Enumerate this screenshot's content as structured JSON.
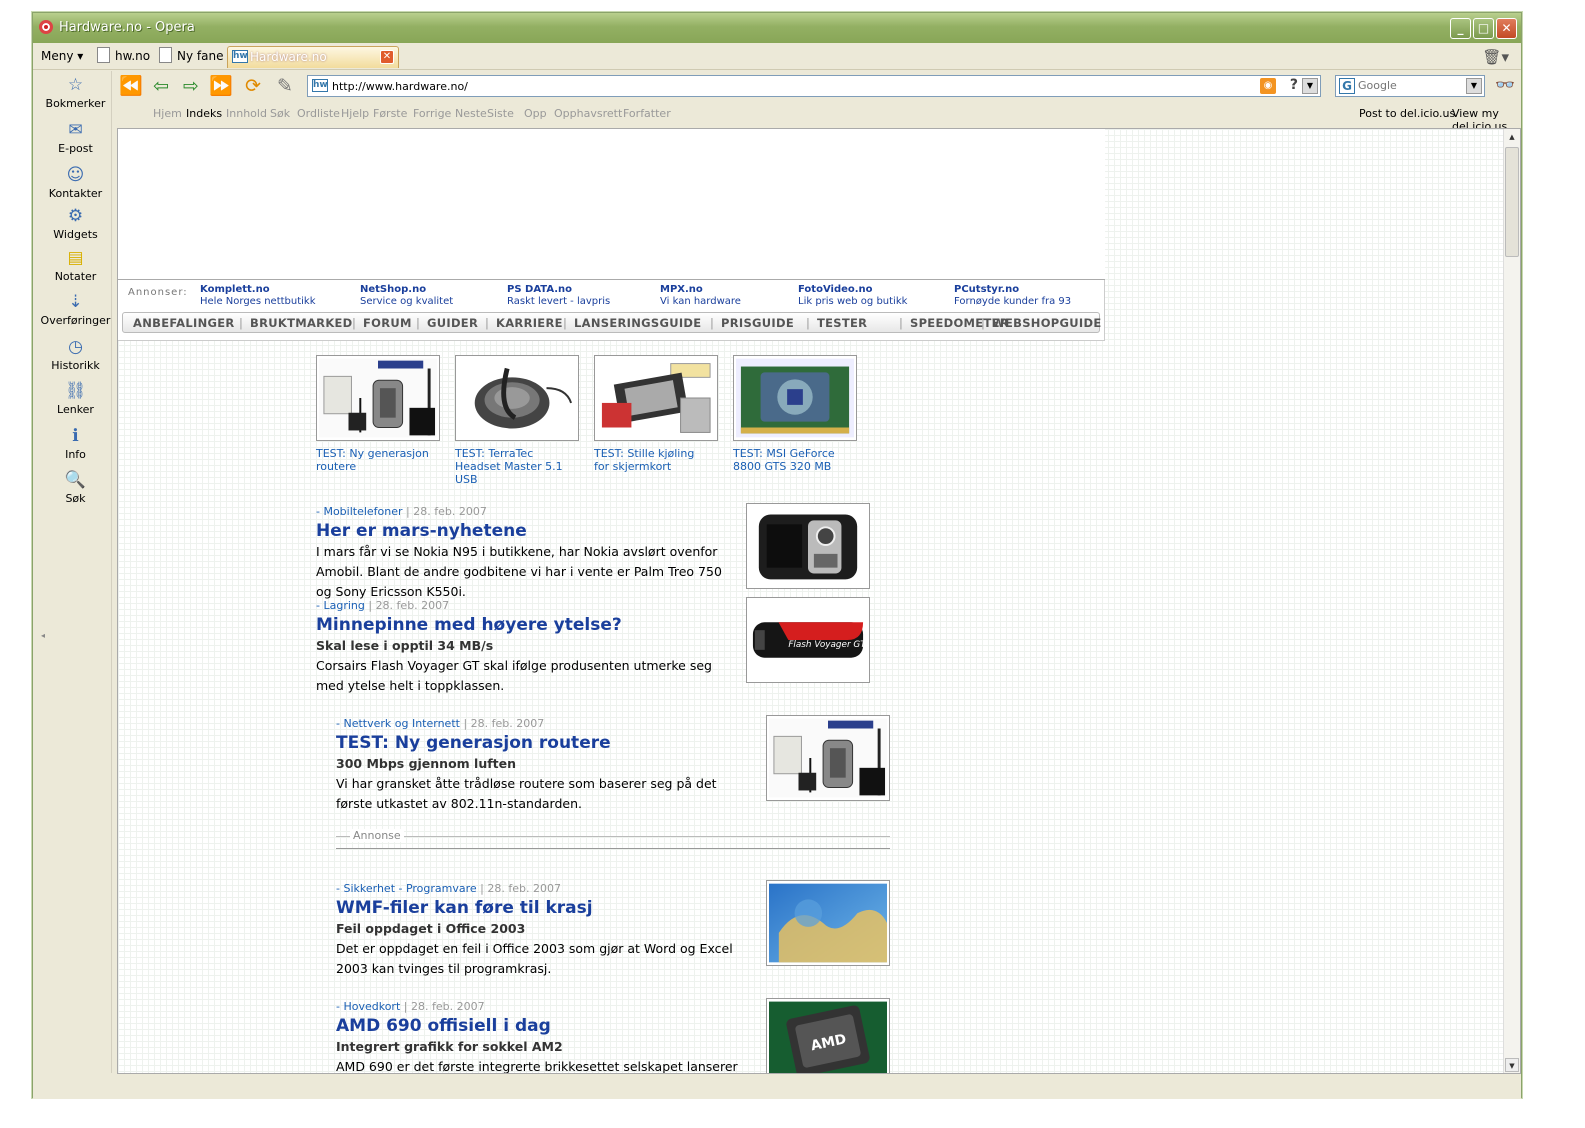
{
  "window": {
    "title": "Hardware.no - Opera"
  },
  "tabbar": {
    "menu_label": "Meny",
    "tabs": [
      {
        "label": "hw.no"
      },
      {
        "label": "Ny fane"
      },
      {
        "label": "Hardware.no",
        "active": true
      }
    ]
  },
  "sidebar": {
    "items": [
      {
        "label": "Bokmerker",
        "icon": "bookmarks-icon"
      },
      {
        "label": "E-post",
        "icon": "mail-icon"
      },
      {
        "label": "Kontakter",
        "icon": "contacts-icon"
      },
      {
        "label": "Widgets",
        "icon": "widgets-icon"
      },
      {
        "label": "Notater",
        "icon": "notes-icon"
      },
      {
        "label": "Overføringer",
        "icon": "transfers-icon"
      },
      {
        "label": "Historikk",
        "icon": "history-icon"
      },
      {
        "label": "Lenker",
        "icon": "links-icon"
      },
      {
        "label": "Info",
        "icon": "info-icon"
      },
      {
        "label": "Søk",
        "icon": "search-icon"
      }
    ]
  },
  "navbar": {
    "address": "http://www.hardware.no/",
    "search_placeholder": "Google"
  },
  "navlinks": {
    "left": [
      "Hjem",
      "Indeks",
      "Innhold",
      "Søk",
      "Ordliste",
      "Hjelp",
      "Første",
      "Forrige",
      "Neste",
      "Siste",
      "Opp",
      "Opphavsrett",
      "Forfatter"
    ],
    "active": "Indeks",
    "right": [
      "Post to del.icio.us",
      "View my del.icio.us"
    ]
  },
  "page": {
    "ads_label": "Annonser:",
    "ads": [
      {
        "name": "Komplett.no",
        "desc": "Hele Norges nettbutikk"
      },
      {
        "name": "NetShop.no",
        "desc": "Service og kvalitet"
      },
      {
        "name": "PS DATA.no",
        "desc": "Raskt levert - lavpris"
      },
      {
        "name": "MPX.no",
        "desc": "Vi kan hardware"
      },
      {
        "name": "FotoVideo.no",
        "desc": "Lik pris web og butikk"
      },
      {
        "name": "PCutstyr.no",
        "desc": "Fornøyde kunder fra 93"
      }
    ],
    "menu": [
      "ANBEFALINGER",
      "BRUKTMARKED",
      "FORUM",
      "GUIDER",
      "KARRIERE",
      "LANSERINGSGUIDE",
      "PRISGUIDE",
      "TESTER",
      "SPEEDOMETER",
      "WEBSHOPGUIDE"
    ],
    "thumbs": [
      {
        "line1": "TEST: Ny generasjon",
        "line2": "routere",
        "line3": ""
      },
      {
        "line1": "TEST: TerraTec",
        "line2": "Headset Master 5.1",
        "line3": "USB"
      },
      {
        "line1": "TEST: Stille kjøling",
        "line2": "for skjermkort",
        "line3": ""
      },
      {
        "line1": "TEST: MSI GeForce",
        "line2": "8800 GTS 320 MB",
        "line3": ""
      }
    ],
    "articles": [
      {
        "cat": "- Mobiltelefoner",
        "sep": " | ",
        "date": "28. feb. 2007",
        "title": "Her er mars-nyhetene",
        "sub": "",
        "body": [
          "I mars får vi se Nokia N95 i butikkene, har Nokia avslørt ovenfor",
          "Amobil. Blant de andre godbitene vi har i vente er Palm Treo 750",
          "og Sony Ericsson K550i."
        ]
      },
      {
        "cat": "- Lagring",
        "sep": " | ",
        "date": "28. feb. 2007",
        "title": "Minnepinne med høyere ytelse?",
        "sub": "Skal lese i opptil 34 MB/s",
        "body": [
          "Corsairs Flash Voyager GT skal ifølge produsenten utmerke seg",
          "med ytelse helt i toppklassen."
        ]
      },
      {
        "cat": "- Nettverk og Internett",
        "sep": " | ",
        "date": "28. feb. 2007",
        "title": "TEST: Ny generasjon routere",
        "sub": "300 Mbps gjennom luften",
        "body": [
          "Vi har gransket åtte trådløse routere som baserer seg på det",
          "første utkastet av 802.11n-standarden."
        ]
      },
      {
        "cat": "- Sikkerhet - Programvare",
        "sep": " | ",
        "date": "28. feb. 2007",
        "title": "WMF-filer kan føre til krasj",
        "sub": "Feil oppdaget i Office 2003",
        "body": [
          "Det er oppdaget en feil i Office 2003 som gjør at Word og Excel",
          "2003 kan tvinges til programkrasj."
        ]
      },
      {
        "cat": "- Hovedkort",
        "sep": " | ",
        "date": "28. feb. 2007",
        "title": "AMD 690 offisiell i dag",
        "sub": "Integrert grafikk for sokkel AM2",
        "body": [
          "AMD 690 er det første integrerte brikkesettet selskapet lanserer",
          ""
        ]
      }
    ],
    "annonse_label": "Annonse",
    "image_texts": {
      "flash": "Flash Voyager GT",
      "amd": "AMD"
    }
  }
}
